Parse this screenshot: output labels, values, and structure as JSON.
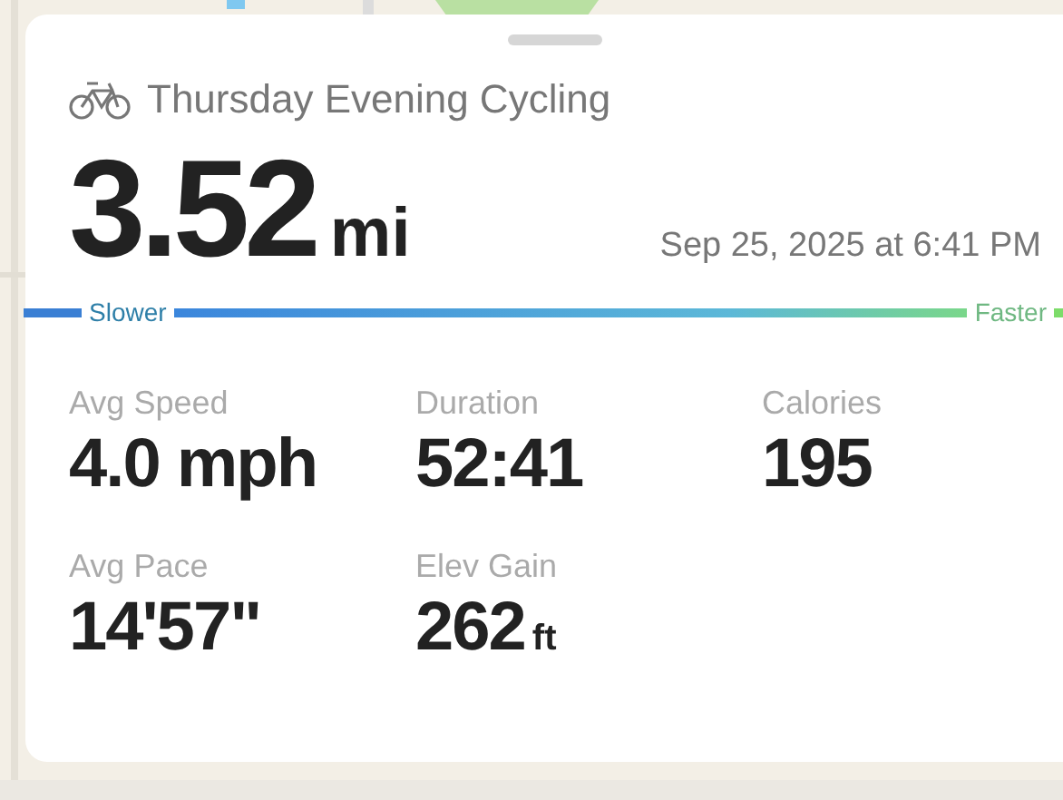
{
  "workout": {
    "title": "Thursday Evening Cycling",
    "distance": "3.52",
    "distance_unit": "mi",
    "date": "Sep 25, 2025 at 6:41 PM"
  },
  "speed_legend": {
    "slow_label": "Slower",
    "fast_label": "Faster"
  },
  "stats": [
    {
      "label": "Avg Speed",
      "value": "4.0 mph"
    },
    {
      "label": "Duration",
      "value": "52:41"
    },
    {
      "label": "Calories",
      "value": "195"
    },
    {
      "label": "Avg Pace",
      "value": "14'57\""
    },
    {
      "label": "Elev Gain",
      "value": "262",
      "unit": "ft"
    }
  ]
}
